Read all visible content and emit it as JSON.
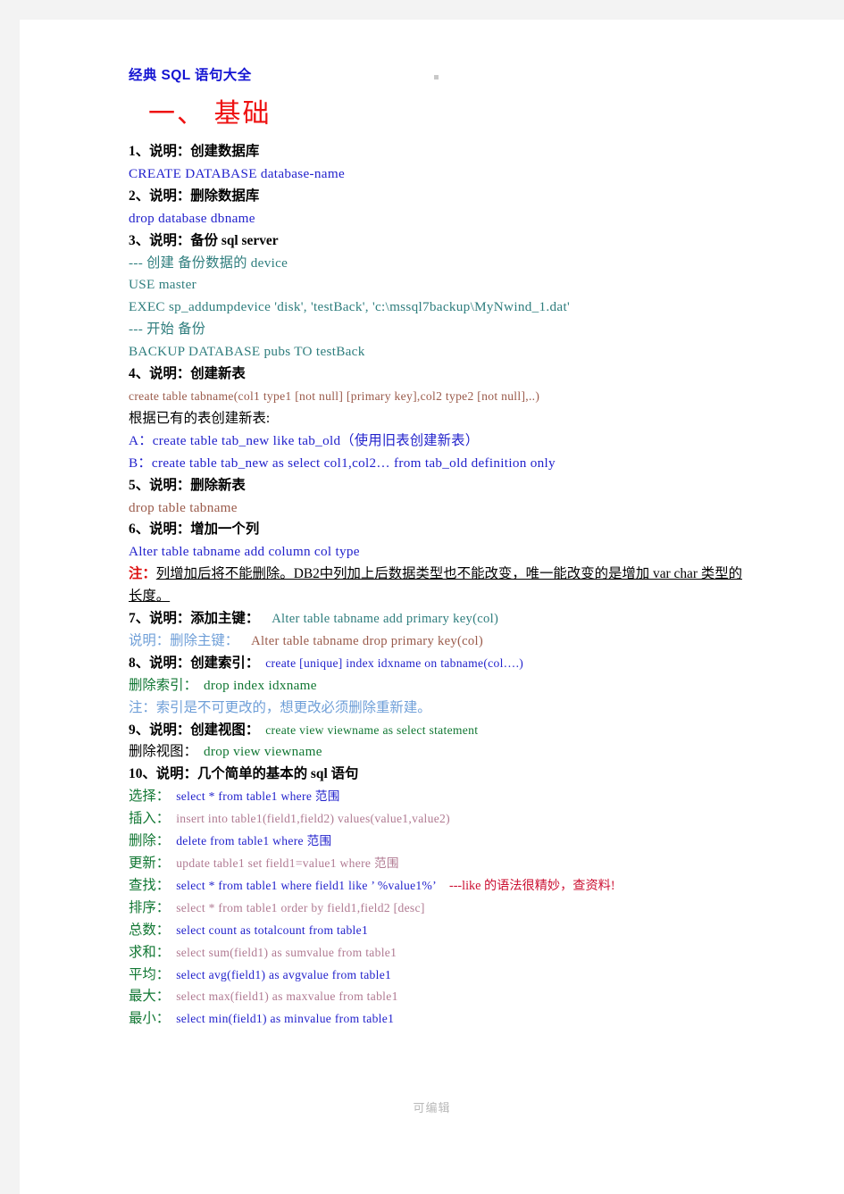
{
  "page": {
    "top_mark": "·",
    "footer": "可编辑"
  },
  "doc": {
    "title": "经典 SQL 语句大全",
    "section_title": "一、 基础"
  },
  "colors": {
    "title_blue": "#1414d2",
    "section_red": "#ee1111",
    "sql_blue": "#2222cc",
    "sql_teal": "#2e7d7d",
    "sql_brown": "#9a5a4a",
    "sql_green": "#117733",
    "sql_mauve": "#b07a92",
    "light_blue": "#6f9fd8",
    "note_red": "#dd1111",
    "footer_gray": "#b9b9b9"
  },
  "items": {
    "i1_label": "1、说明：创建数据库",
    "i1_sql": "CREATE   DATABASE   database-name",
    "i2_label": "2、说明：删除数据库",
    "i2_sql": "drop   database   dbname",
    "i3_label": "3、说明：备份 sql   server",
    "i3_c1": "---  创建  备份数据的  device",
    "i3_c2": "USE   master",
    "i3_c3": "EXEC   sp_addumpdevice  'disk',  'testBack',  'c:\\mssql7backup\\MyNwind_1.dat'",
    "i3_c4": "---  开始  备份",
    "i3_c5": "BACKUP   DATABASE   pubs   TO   testBack",
    "i4_label": "4、说明：创建新表",
    "i4_sql": "create   table   tabname(col1   type1   [not   null]   [primary   key],col2   type2   [not   null],..)",
    "i4_sub": "根据已有的表创建新表:",
    "i4_a": "A：create   table   tab_new   like   tab_old（使用旧表创建新表）",
    "i4_b": "B：create   table   tab_new   as   select   col1,col2…   from   tab_old   definition   only",
    "i5_label": "5、说明：删除新表",
    "i5_sql": "drop   table   tabname",
    "i6_label": "6、说明：增加一个列",
    "i6_sql": "Alter   table   tabname   add   column   col   type",
    "i6_note_prefix": "注：",
    "i6_note_body": "列增加后将不能删除。DB2中列加上后数据类型也不能改变，唯一能改变的是增加  var char 类型的长度。",
    "i7_label": "7、说明：添加主键：",
    "i7_sql": "Alter   table   tabname   add   primary   key(col)",
    "i7b_label": "说明：删除主键：",
    "i7b_sql": "Alter   table   tabname   drop   primary   key(col)",
    "i8_label": "8、说明：创建索引：",
    "i8_sql": "create   [unique]   index   idxname   on   tabname(col….)",
    "i8b_label": "删除索引：",
    "i8b_sql": "drop   index   idxname",
    "i8_note": "注：索引是不可更改的，想更改必须删除重新建。",
    "i9_label": "9、说明：创建视图：",
    "i9_sql": "create   view   viewname   as   select   statement",
    "i9b_label": "删除视图：",
    "i9b_sql": "drop   view   viewname",
    "i10_label": "10、说明：几个简单的基本的 sql 语句"
  },
  "basics": [
    {
      "label": "选择：",
      "sql": "select  *  from  table1  where  范围",
      "color": "c-blue",
      "label_color": "c-green"
    },
    {
      "label": "插入：",
      "sql": "insert   into   table1(field1,field2)   values(value1,value2)",
      "color": "c-mauve",
      "label_color": "c-green"
    },
    {
      "label": "删除：",
      "sql": "delete   from   table1   where   范围",
      "color": "c-blue",
      "label_color": "c-green"
    },
    {
      "label": "更新：",
      "sql": "update   table1   set   field1=value1   where   范围",
      "color": "c-mauve",
      "label_color": "c-green"
    },
    {
      "label": "查找：",
      "sql": "select  *  from  table1  where  field1  like  ’ %value1%’",
      "color": "c-blue",
      "label_color": "c-green",
      "comment": "---like 的语法很精妙，查资料!"
    },
    {
      "label": "排序：",
      "sql": "select  *  from  table1  order  by  field1,field2  [desc]",
      "color": "c-mauve",
      "label_color": "c-green"
    },
    {
      "label": "总数：",
      "sql": "select   count   as   totalcount   from   table1",
      "color": "c-blue",
      "label_color": "c-green"
    },
    {
      "label": "求和：",
      "sql": "select   sum(field1)   as   sumvalue   from   table1",
      "color": "c-mauve",
      "label_color": "c-green"
    },
    {
      "label": "平均：",
      "sql": "select   avg(field1)   as   avgvalue   from   table1",
      "color": "c-blue",
      "label_color": "c-green"
    },
    {
      "label": "最大：",
      "sql": "select   max(field1)   as   maxvalue   from   table1",
      "color": "c-mauve",
      "label_color": "c-green"
    },
    {
      "label": "最小：",
      "sql": "select   min(field1)   as   minvalue   from   table1",
      "color": "c-blue",
      "label_color": "c-green"
    }
  ]
}
